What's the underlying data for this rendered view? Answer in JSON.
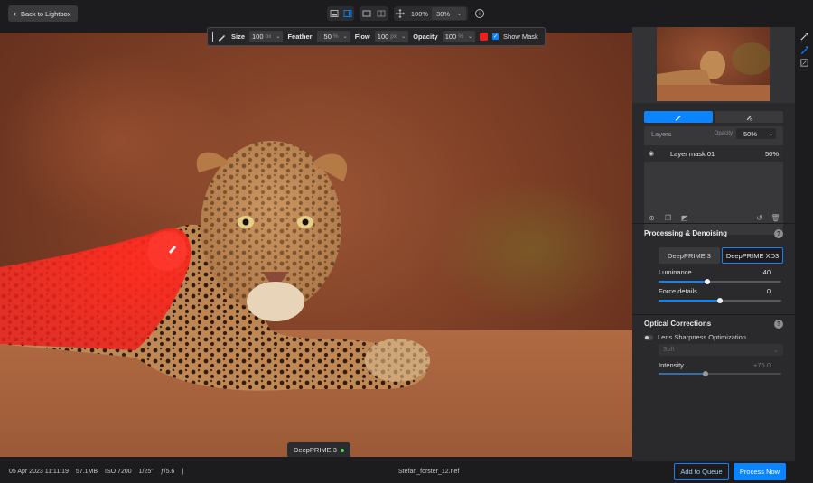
{
  "header": {
    "back_label": "Back to Lightbox",
    "zoom_fit": "100%",
    "zoom_select": "30%"
  },
  "brush_toolbar": {
    "size_label": "Size",
    "size_value": "100",
    "size_unit": "px",
    "feather_label": "Feather",
    "feather_value": "50",
    "feather_unit": "%",
    "flow_label": "Flow",
    "flow_value": "100",
    "flow_unit": "px",
    "opacity_label": "Opacity",
    "opacity_value": "100",
    "opacity_unit": "%",
    "mask_color": "#e8211e",
    "show_mask_label": "Show Mask"
  },
  "canvas": {
    "engine_badge": "DeepPRIME 3"
  },
  "layers": {
    "title": "Layers",
    "opacity_label": "Opacity",
    "opacity_value": "50%",
    "items": [
      {
        "name": "Layer mask 01",
        "opacity": "50%"
      }
    ]
  },
  "processing": {
    "title": "Processing & Denoising",
    "help": "?",
    "options": [
      "DeepPRIME 3",
      "DeepPRIME XD3"
    ],
    "selected": "DeepPRIME XD3",
    "luminance_label": "Luminance",
    "luminance_value": "40",
    "luminance_level": 0.4,
    "force_details_label": "Force details",
    "force_details_value": "0",
    "force_details_level": 0.5
  },
  "optical": {
    "title": "Optical Corrections",
    "help": "?",
    "lso_label": "Lens Sharpness Optimization",
    "soft_select": "Soft",
    "intensity_label": "Intensity",
    "intensity_value": "+75.0",
    "intensity_level": 0.38
  },
  "footer": {
    "date": "05 Apr 2023 11:11:19",
    "size": "57.1MB",
    "iso": "ISO 7200",
    "shutter": "1/25\"",
    "aperture": "ƒ/5.6",
    "sep": "|",
    "filename": "Stefan_forster_12.nef",
    "queue_label": "Add to Queue",
    "process_label": "Process Now"
  },
  "colors": {
    "accent": "#0a84ff",
    "mask": "#e8211e"
  }
}
